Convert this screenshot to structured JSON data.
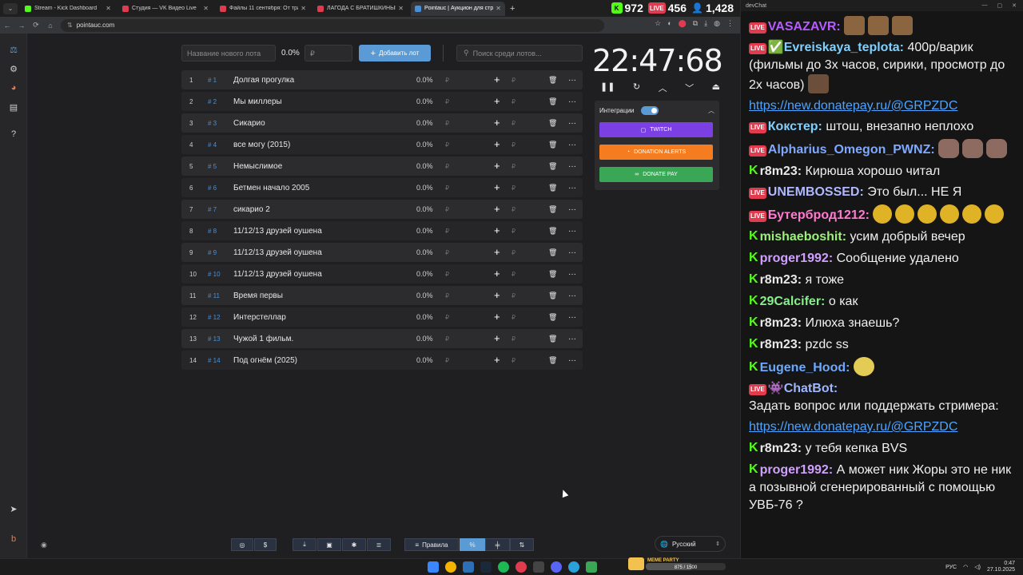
{
  "browser": {
    "tabs": [
      {
        "title": "Stream - Kick Dashboard",
        "color": "#53fc18"
      },
      {
        "title": "Студия — VK Видео Live",
        "color": "#e03b4f"
      },
      {
        "title": "Файлы 11 сентября: От трагед",
        "color": "#e03b4f"
      },
      {
        "title": "ЛАГОДА С БРАТИШКИНЫМ З",
        "color": "#e03b4f"
      },
      {
        "title": "Pointauc | Аукцион для стрим",
        "color": "#4a90d9"
      }
    ],
    "url": "pointauc.com",
    "stats": {
      "kick": "972",
      "vk": "456",
      "viewers": "1,428",
      "live_badge": "LIVE"
    }
  },
  "controls": {
    "name_placeholder": "Название нового лота",
    "percent": "0.0%",
    "amount_placeholder": "₽",
    "add_label": "Добавить лот",
    "search_placeholder": "Поиск среди лотов..."
  },
  "lots": [
    {
      "index": "1",
      "tag": "# 1",
      "name": "Долгая прогулка",
      "percent": "0.0%"
    },
    {
      "index": "2",
      "tag": "# 2",
      "name": "Мы миллеры",
      "percent": "0.0%"
    },
    {
      "index": "3",
      "tag": "# 3",
      "name": "Сикарио",
      "percent": "0.0%"
    },
    {
      "index": "4",
      "tag": "# 4",
      "name": "все могу (2015)",
      "percent": "0.0%"
    },
    {
      "index": "5",
      "tag": "# 5",
      "name": "Немыслимое",
      "percent": "0.0%"
    },
    {
      "index": "6",
      "tag": "# 6",
      "name": "Бетмен начало 2005",
      "percent": "0.0%"
    },
    {
      "index": "7",
      "tag": "# 7",
      "name": "сикарио 2",
      "percent": "0.0%"
    },
    {
      "index": "8",
      "tag": "# 8",
      "name": "11/12/13 друзей оушена",
      "percent": "0.0%"
    },
    {
      "index": "9",
      "tag": "# 9",
      "name": "11/12/13 друзей оушена",
      "percent": "0.0%"
    },
    {
      "index": "10",
      "tag": "# 10",
      "name": "11/12/13 друзей оушена",
      "percent": "0.0%"
    },
    {
      "index": "11",
      "tag": "# 11",
      "name": "Время первы",
      "percent": "0.0%"
    },
    {
      "index": "12",
      "tag": "# 12",
      "name": "Интерстеллар",
      "percent": "0.0%"
    },
    {
      "index": "13",
      "tag": "# 13",
      "name": "Чужой 1 фильм.",
      "percent": "0.0%"
    },
    {
      "index": "14",
      "tag": "# 14",
      "name": "Под огнём (2025)",
      "percent": "0.0%"
    }
  ],
  "timer": {
    "display": "22:47:68"
  },
  "integrations": {
    "label": "Интеграции",
    "twitch": "TWITCH",
    "donation_alerts": "DONATION ALERTS",
    "donate_pay": "DONATE PAY",
    "colors": {
      "twitch": "#7b3fe4",
      "da": "#f57c1f",
      "dp": "#3aa757"
    }
  },
  "bottom": {
    "rules_label": "Правила",
    "percent_label": "%",
    "language": "Русский"
  },
  "chat": {
    "title": "devChat",
    "messages": [
      {
        "platform": "vk",
        "user": "VASAZAVR:",
        "color": "#b65cff",
        "text": "",
        "emotes": [
          "bear",
          "bear",
          "bear"
        ]
      },
      {
        "platform": "vk",
        "user": "✅Evreiskaya_teplota:",
        "color": "#7fd0ff",
        "text": "400р/варик (фильмы до 3х часов, сирики, просмотр до 2х часов)",
        "emotes": [
          "tea"
        ]
      },
      {
        "platform": "none",
        "user": "",
        "color": "",
        "link": "https://new.donatepay.ru/@GRPZDC"
      },
      {
        "platform": "vk",
        "user": "Кокстер:",
        "color": "#7fd0ff",
        "text": "штош, внезапно неплохо"
      },
      {
        "platform": "vk",
        "user": "Alpharius_Omegon_PWNZ:",
        "color": "#7fa8ff",
        "text": "",
        "emotes": [
          "cat",
          "cat",
          "cat"
        ]
      },
      {
        "platform": "kick",
        "user": "r8m23:",
        "color": "#e8e8e8",
        "text": "Кирюша хорошо читал"
      },
      {
        "platform": "vk",
        "user": "UNEMBOSSED:",
        "color": "#b0b8ff",
        "text": "Это был... НЕ Я"
      },
      {
        "platform": "vk",
        "user": "Бутерброд1212:",
        "color": "#ff7bd0",
        "text": "",
        "emotes": [
          "gold",
          "gold",
          "gold",
          "gold",
          "gold",
          "gold"
        ]
      },
      {
        "platform": "kick",
        "user": "mishaeboshit:",
        "color": "#9cf07b",
        "text": "усим добрый вечер"
      },
      {
        "platform": "kick",
        "user": "proger1992:",
        "color": "#d0a0ff",
        "text": "Сообщение удалено"
      },
      {
        "platform": "kick",
        "user": "r8m23:",
        "color": "#e8e8e8",
        "text": "я тоже"
      },
      {
        "platform": "kick",
        "user": "29Calcifer:",
        "color": "#86f08a",
        "text": "о как"
      },
      {
        "platform": "kick",
        "user": "r8m23:",
        "color": "#e8e8e8",
        "text": "Илюха знаешь?"
      },
      {
        "platform": "kick",
        "user": "r8m23:",
        "color": "#e8e8e8",
        "text": "pzdc ss"
      },
      {
        "platform": "kick",
        "user": "Eugene_Hood:",
        "color": "#6aa9ff",
        "text": "",
        "emotes": [
          "moon"
        ]
      },
      {
        "platform": "vk",
        "user": "👾ChatBot:",
        "color": "#9fb6ff",
        "text": "Задать вопрос или поддержать стримера:",
        "newline": true
      },
      {
        "platform": "none",
        "user": "",
        "color": "",
        "link": "https://new.donatepay.ru/@GRPZDC"
      },
      {
        "platform": "kick",
        "user": "r8m23:",
        "color": "#e8e8e8",
        "text": "у тебя кепка BVS"
      },
      {
        "platform": "kick",
        "user": "proger1992:",
        "color": "#d0a0ff",
        "text": "А может ник Жоры это не ник а позывной сгенерированный с помощью УВБ-76 ?"
      }
    ]
  },
  "taskbar": {
    "lang": "РУС",
    "time": "0:47",
    "date": "27.10.2025",
    "meme_title": "MEME PARTY",
    "meme_progress": "875 / 1500"
  }
}
